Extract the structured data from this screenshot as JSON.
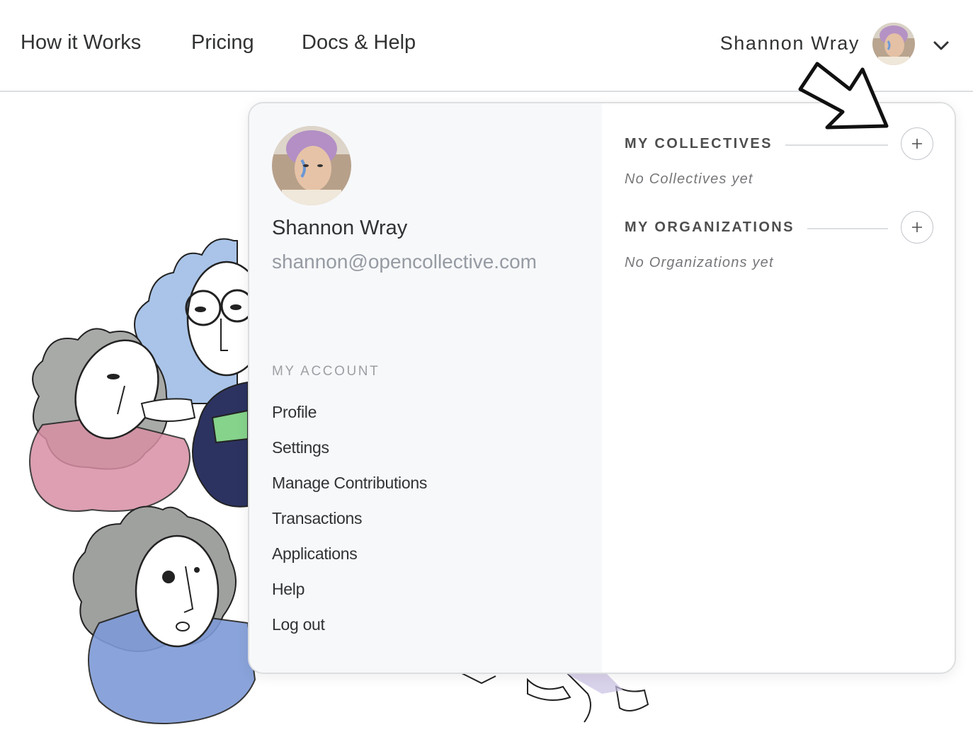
{
  "nav": {
    "links": [
      "How it Works",
      "Pricing",
      "Docs & Help"
    ],
    "user_name": "Shannon Wray"
  },
  "menu": {
    "profile": {
      "name": "Shannon Wray",
      "email": "shannon@opencollective.com"
    },
    "account_section_label": "MY ACCOUNT",
    "account_items": [
      "Profile",
      "Settings",
      "Manage Contributions",
      "Transactions",
      "Applications",
      "Help",
      "Log out"
    ],
    "collectives": {
      "title": "MY COLLECTIVES",
      "empty": "No Collectives yet"
    },
    "organizations": {
      "title": "MY ORGANIZATIONS",
      "empty": "No Organizations yet"
    }
  },
  "icons": {
    "avatar": "user-avatar-photo",
    "chevron": "chevron-down-icon",
    "add": "plus-icon",
    "annotation": "arrow-annotation-icon"
  },
  "colors": {
    "text": "#313233",
    "muted": "#969ba3",
    "pane_bg": "#f7f8fa",
    "border": "#dcdee0"
  }
}
